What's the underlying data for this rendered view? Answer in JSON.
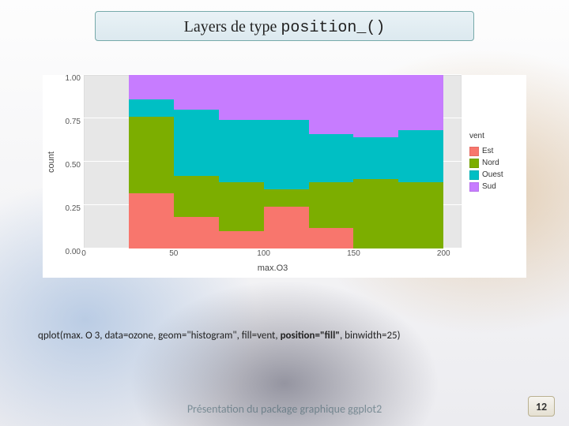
{
  "title_prefix": "Layers de type ",
  "title_mono": "position_()",
  "caption": {
    "p1": "qplot(max. O 3, data=ozone, geom=\"histogram\", fill=vent, ",
    "bold": "position=\"fill\"",
    "p2": ", binwidth=25)"
  },
  "footer": "Présentation du package graphique ggplot2",
  "page_number": "12",
  "chart_data": {
    "type": "bar",
    "stack_mode": "fill",
    "xlabel": "max.O3",
    "ylabel": "count",
    "ylim": [
      0,
      1
    ],
    "yticks": [
      0.0,
      0.25,
      0.5,
      0.75,
      1.0
    ],
    "xticks": [
      0,
      50,
      100,
      150,
      200
    ],
    "xlim": [
      0,
      210
    ],
    "legend_title": "vent",
    "colors": {
      "Est": "#f8766d",
      "Nord": "#7cae00",
      "Ouest": "#00bfc4",
      "Sud": "#c77cff"
    },
    "legend_order": [
      "Est",
      "Nord",
      "Ouest",
      "Sud"
    ],
    "bins": [
      {
        "x": 37.5,
        "Est": 0.32,
        "Nord": 0.44,
        "Ouest": 0.1,
        "Sud": 0.14
      },
      {
        "x": 62.5,
        "Est": 0.18,
        "Nord": 0.24,
        "Ouest": 0.38,
        "Sud": 0.2
      },
      {
        "x": 87.5,
        "Est": 0.1,
        "Nord": 0.28,
        "Ouest": 0.36,
        "Sud": 0.26
      },
      {
        "x": 112.5,
        "Est": 0.24,
        "Nord": 0.1,
        "Ouest": 0.4,
        "Sud": 0.26
      },
      {
        "x": 137.5,
        "Est": 0.12,
        "Nord": 0.26,
        "Ouest": 0.28,
        "Sud": 0.34
      },
      {
        "x": 162.5,
        "Est": 0.0,
        "Nord": 0.4,
        "Ouest": 0.24,
        "Sud": 0.36
      },
      {
        "x": 187.5,
        "Est": 0.0,
        "Nord": 0.38,
        "Ouest": 0.3,
        "Sud": 0.32
      }
    ],
    "bin_width_x": 25
  }
}
